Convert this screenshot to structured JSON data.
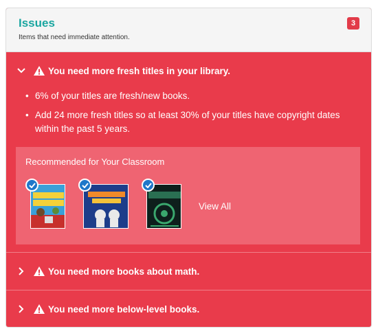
{
  "panel": {
    "title": "Issues",
    "subtitle": "Items that need immediate attention.",
    "count": "3"
  },
  "issues": [
    {
      "title": "You need more fresh titles in your library.",
      "expanded": true,
      "bullets": [
        "6% of your titles are fresh/new books.",
        "Add 24 more fresh titles so at least 30% of your titles have copyright dates within the past 5 years."
      ],
      "recommendations": {
        "title": "Recommended for Your Classroom",
        "books": [
          {
            "name": "book-cover-simple-machines",
            "cover_text": "SIMPLE MACHINES!",
            "checked": true
          },
          {
            "name": "book-cover-space-exploration",
            "cover_text": "Space Exploration",
            "checked": true
          },
          {
            "name": "book-cover-dark-green",
            "cover_text": "",
            "checked": true
          }
        ],
        "view_all_label": "View All"
      }
    },
    {
      "title": "You need more books about math.",
      "expanded": false
    },
    {
      "title": "You need more below-level books.",
      "expanded": false
    }
  ],
  "colors": {
    "accent": "#1aa6a0",
    "issue_bg": "#e93b4b",
    "rec_bg": "#ef6472",
    "check": "#1f77c9"
  }
}
